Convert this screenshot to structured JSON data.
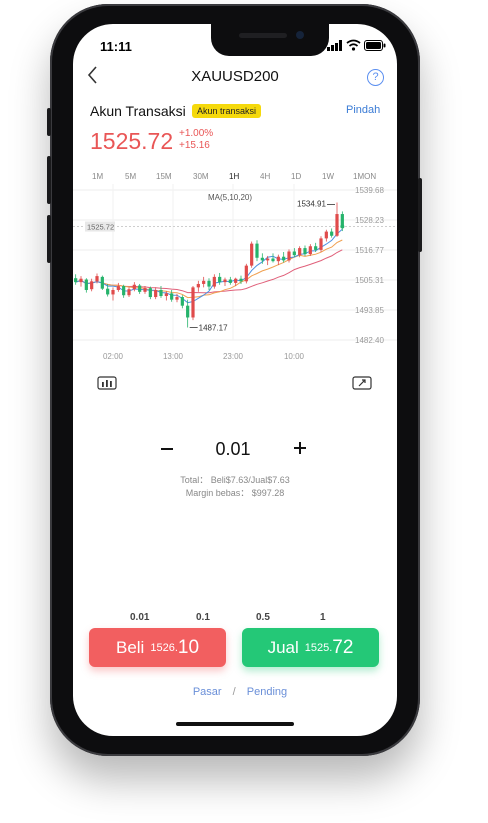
{
  "status_bar": {
    "time": "11:11"
  },
  "nav": {
    "title": "XAUUSD200",
    "help_label": "?"
  },
  "account": {
    "title": "Akun Transaksi",
    "badge": "Akun transaksi",
    "switch_label": "Pindah"
  },
  "quote": {
    "price": "1525.72",
    "change_pct": "+1.00%",
    "change_abs": "+15.16"
  },
  "timeframes": [
    {
      "label": "1M",
      "active": false
    },
    {
      "label": "5M",
      "active": false
    },
    {
      "label": "15M",
      "active": false
    },
    {
      "label": "30M",
      "active": false
    },
    {
      "label": "1H",
      "active": true
    },
    {
      "label": "4H",
      "active": false
    },
    {
      "label": "1D",
      "active": false
    },
    {
      "label": "1W",
      "active": false
    },
    {
      "label": "1MON",
      "active": false
    }
  ],
  "chart_data": {
    "type": "candlestick",
    "indicator_label": "MA(5,10,20)",
    "ylim": [
      1482.4,
      1539.68
    ],
    "y_ticks": [
      "1539.68",
      "1528.23",
      "1516.77",
      "1505.31",
      "1493.85",
      "1482.40"
    ],
    "x_ticks": [
      "02:00",
      "13:00",
      "23:00",
      "10:00"
    ],
    "current_price_label": "1525.72",
    "current_price": 1525.72,
    "high_label": "1534.91",
    "high_value": 1534.91,
    "low_label": "1487.17",
    "low_value": 1487.17,
    "colors": {
      "up": "#e04b4b",
      "down": "#25b36b",
      "ma5": "#4a90e2",
      "ma10": "#f0a050",
      "ma20": "#e0607a"
    },
    "candles": [
      {
        "o": 1506.0,
        "h": 1507.5,
        "l": 1503.5,
        "c": 1504.5
      },
      {
        "o": 1504.5,
        "h": 1506.8,
        "l": 1502.8,
        "c": 1505.8
      },
      {
        "o": 1505.5,
        "h": 1506.0,
        "l": 1500.5,
        "c": 1501.5
      },
      {
        "o": 1501.8,
        "h": 1505.8,
        "l": 1501.0,
        "c": 1504.8
      },
      {
        "o": 1504.8,
        "h": 1507.8,
        "l": 1504.0,
        "c": 1506.8
      },
      {
        "o": 1506.5,
        "h": 1507.0,
        "l": 1501.5,
        "c": 1502.0
      },
      {
        "o": 1502.0,
        "h": 1503.8,
        "l": 1499.0,
        "c": 1499.8
      },
      {
        "o": 1499.8,
        "h": 1502.5,
        "l": 1497.5,
        "c": 1501.5
      },
      {
        "o": 1501.5,
        "h": 1504.2,
        "l": 1500.8,
        "c": 1503.0
      },
      {
        "o": 1503.0,
        "h": 1503.5,
        "l": 1498.5,
        "c": 1499.5
      },
      {
        "o": 1499.5,
        "h": 1502.5,
        "l": 1498.8,
        "c": 1501.8
      },
      {
        "o": 1501.8,
        "h": 1504.5,
        "l": 1501.0,
        "c": 1503.5
      },
      {
        "o": 1503.2,
        "h": 1503.8,
        "l": 1500.0,
        "c": 1500.8
      },
      {
        "o": 1500.8,
        "h": 1503.0,
        "l": 1500.0,
        "c": 1502.2
      },
      {
        "o": 1502.2,
        "h": 1502.8,
        "l": 1498.0,
        "c": 1498.8
      },
      {
        "o": 1498.8,
        "h": 1502.5,
        "l": 1498.0,
        "c": 1501.5
      },
      {
        "o": 1501.5,
        "h": 1503.0,
        "l": 1498.5,
        "c": 1499.2
      },
      {
        "o": 1499.2,
        "h": 1501.0,
        "l": 1497.5,
        "c": 1500.2
      },
      {
        "o": 1500.2,
        "h": 1501.5,
        "l": 1497.0,
        "c": 1497.8
      },
      {
        "o": 1497.8,
        "h": 1500.0,
        "l": 1496.8,
        "c": 1498.8
      },
      {
        "o": 1498.8,
        "h": 1499.5,
        "l": 1494.5,
        "c": 1495.5
      },
      {
        "o": 1495.5,
        "h": 1497.8,
        "l": 1487.17,
        "c": 1491.0
      },
      {
        "o": 1491.0,
        "h": 1503.0,
        "l": 1490.0,
        "c": 1502.5
      },
      {
        "o": 1502.5,
        "h": 1505.0,
        "l": 1500.8,
        "c": 1503.8
      },
      {
        "o": 1503.8,
        "h": 1506.5,
        "l": 1502.5,
        "c": 1505.0
      },
      {
        "o": 1505.0,
        "h": 1506.0,
        "l": 1501.5,
        "c": 1502.8
      },
      {
        "o": 1502.8,
        "h": 1507.5,
        "l": 1502.0,
        "c": 1506.5
      },
      {
        "o": 1506.5,
        "h": 1508.0,
        "l": 1503.5,
        "c": 1504.5
      },
      {
        "o": 1504.5,
        "h": 1506.2,
        "l": 1503.0,
        "c": 1505.5
      },
      {
        "o": 1505.5,
        "h": 1506.5,
        "l": 1503.5,
        "c": 1504.2
      },
      {
        "o": 1504.2,
        "h": 1506.2,
        "l": 1503.0,
        "c": 1505.8
      },
      {
        "o": 1505.8,
        "h": 1507.0,
        "l": 1503.8,
        "c": 1504.8
      },
      {
        "o": 1504.8,
        "h": 1511.5,
        "l": 1504.0,
        "c": 1510.8
      },
      {
        "o": 1510.8,
        "h": 1520.0,
        "l": 1510.0,
        "c": 1519.2
      },
      {
        "o": 1519.2,
        "h": 1520.5,
        "l": 1512.5,
        "c": 1513.8
      },
      {
        "o": 1513.8,
        "h": 1515.5,
        "l": 1511.5,
        "c": 1512.8
      },
      {
        "o": 1512.8,
        "h": 1514.5,
        "l": 1511.0,
        "c": 1513.5
      },
      {
        "o": 1513.5,
        "h": 1515.5,
        "l": 1512.0,
        "c": 1512.5
      },
      {
        "o": 1512.5,
        "h": 1515.0,
        "l": 1511.0,
        "c": 1514.2
      },
      {
        "o": 1514.2,
        "h": 1516.0,
        "l": 1512.0,
        "c": 1512.8
      },
      {
        "o": 1512.8,
        "h": 1517.0,
        "l": 1512.0,
        "c": 1516.2
      },
      {
        "o": 1516.2,
        "h": 1517.5,
        "l": 1514.0,
        "c": 1514.8
      },
      {
        "o": 1514.8,
        "h": 1518.2,
        "l": 1514.0,
        "c": 1517.5
      },
      {
        "o": 1517.5,
        "h": 1518.5,
        "l": 1514.5,
        "c": 1515.2
      },
      {
        "o": 1515.2,
        "h": 1519.0,
        "l": 1514.5,
        "c": 1518.2
      },
      {
        "o": 1518.2,
        "h": 1519.5,
        "l": 1516.0,
        "c": 1516.8
      },
      {
        "o": 1516.8,
        "h": 1522.0,
        "l": 1516.0,
        "c": 1521.2
      },
      {
        "o": 1521.2,
        "h": 1524.5,
        "l": 1520.0,
        "c": 1523.8
      },
      {
        "o": 1523.8,
        "h": 1525.0,
        "l": 1521.5,
        "c": 1522.2
      },
      {
        "o": 1522.2,
        "h": 1534.91,
        "l": 1521.8,
        "c": 1530.5
      },
      {
        "o": 1530.5,
        "h": 1531.5,
        "l": 1524.0,
        "c": 1525.72
      }
    ]
  },
  "chart_controls": {
    "indicator_icon": "bar-chart-icon",
    "fullscreen_icon": "expand-icon"
  },
  "order": {
    "minus_label": "−",
    "plus_label": "+",
    "quantity": "0.01",
    "total_text": "Total： Beli$7.63/Jual$7.63",
    "margin_text": "Margin bebas： $997.28",
    "presets": [
      "0.01",
      "0.1",
      "0.5",
      "1"
    ]
  },
  "buttons": {
    "buy_label": "Beli",
    "buy_price_small": "1526.",
    "buy_price_big": "10",
    "sell_label": "Jual",
    "sell_price_small": "1525.",
    "sell_price_big": "72"
  },
  "order_types": {
    "market": "Pasar",
    "separator": "/",
    "pending": "Pending"
  }
}
